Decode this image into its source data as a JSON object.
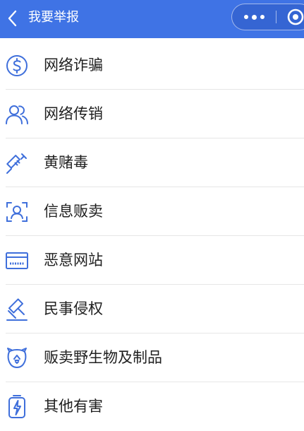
{
  "header": {
    "title": "我要举报",
    "bg_color": "#3f73e5",
    "back_icon": "chevron-left-icon",
    "more_icon": "more-dots-icon",
    "close_icon": "target-circle-icon"
  },
  "list": {
    "icon_color": "#3f6fdb",
    "items": [
      {
        "label": "网络诈骗",
        "icon": "dollar-circle-icon"
      },
      {
        "label": "网络传销",
        "icon": "people-icon"
      },
      {
        "label": "黄赌毒",
        "icon": "syringe-icon"
      },
      {
        "label": "信息贩卖",
        "icon": "face-scan-icon"
      },
      {
        "label": "恶意网站",
        "icon": "browser-window-icon"
      },
      {
        "label": "民事侵权",
        "icon": "gavel-icon"
      },
      {
        "label": "贩卖野生物及制品",
        "icon": "animal-face-icon"
      },
      {
        "label": "其他有害",
        "icon": "battery-bolt-icon"
      }
    ]
  }
}
